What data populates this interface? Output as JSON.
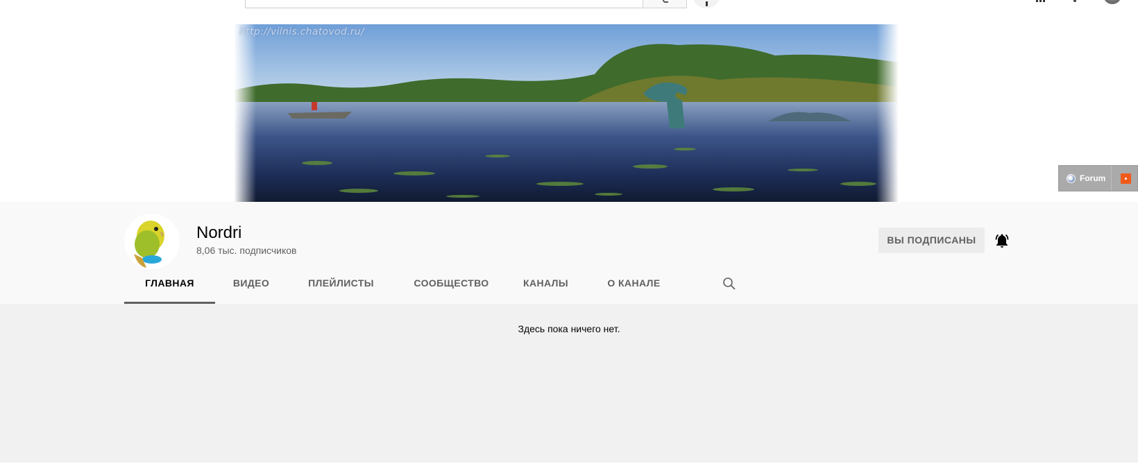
{
  "banner": {
    "watermark": "http://vilnis.chatovod.ru/"
  },
  "forum_widget": {
    "label": "Forum"
  },
  "channel": {
    "name": "Nordri",
    "subscribers": "8,06 тыс. подписчиков",
    "subscribe_button_label": "ВЫ ПОДПИСАНЫ"
  },
  "tabs": [
    {
      "label": "ГЛАВНАЯ",
      "active": true
    },
    {
      "label": "ВИДЕО",
      "active": false
    },
    {
      "label": "ПЛЕЙЛИСТЫ",
      "active": false
    },
    {
      "label": "СООБЩЕСТВО",
      "active": false
    },
    {
      "label": "КАНАЛЫ",
      "active": false
    },
    {
      "label": "О КАНАЛЕ",
      "active": false
    }
  ],
  "content": {
    "empty_message": "Здесь пока ничего нет."
  },
  "icons": {
    "tab_search": "search-icon",
    "notifications": "bell-icon",
    "forum": "globe-icon",
    "feed": "rss-icon"
  },
  "colors": {
    "header_background": "#f9f9f9",
    "content_background": "#f1f1f1",
    "active_tab_underline": "#606060",
    "rss": "#f05a1a"
  }
}
